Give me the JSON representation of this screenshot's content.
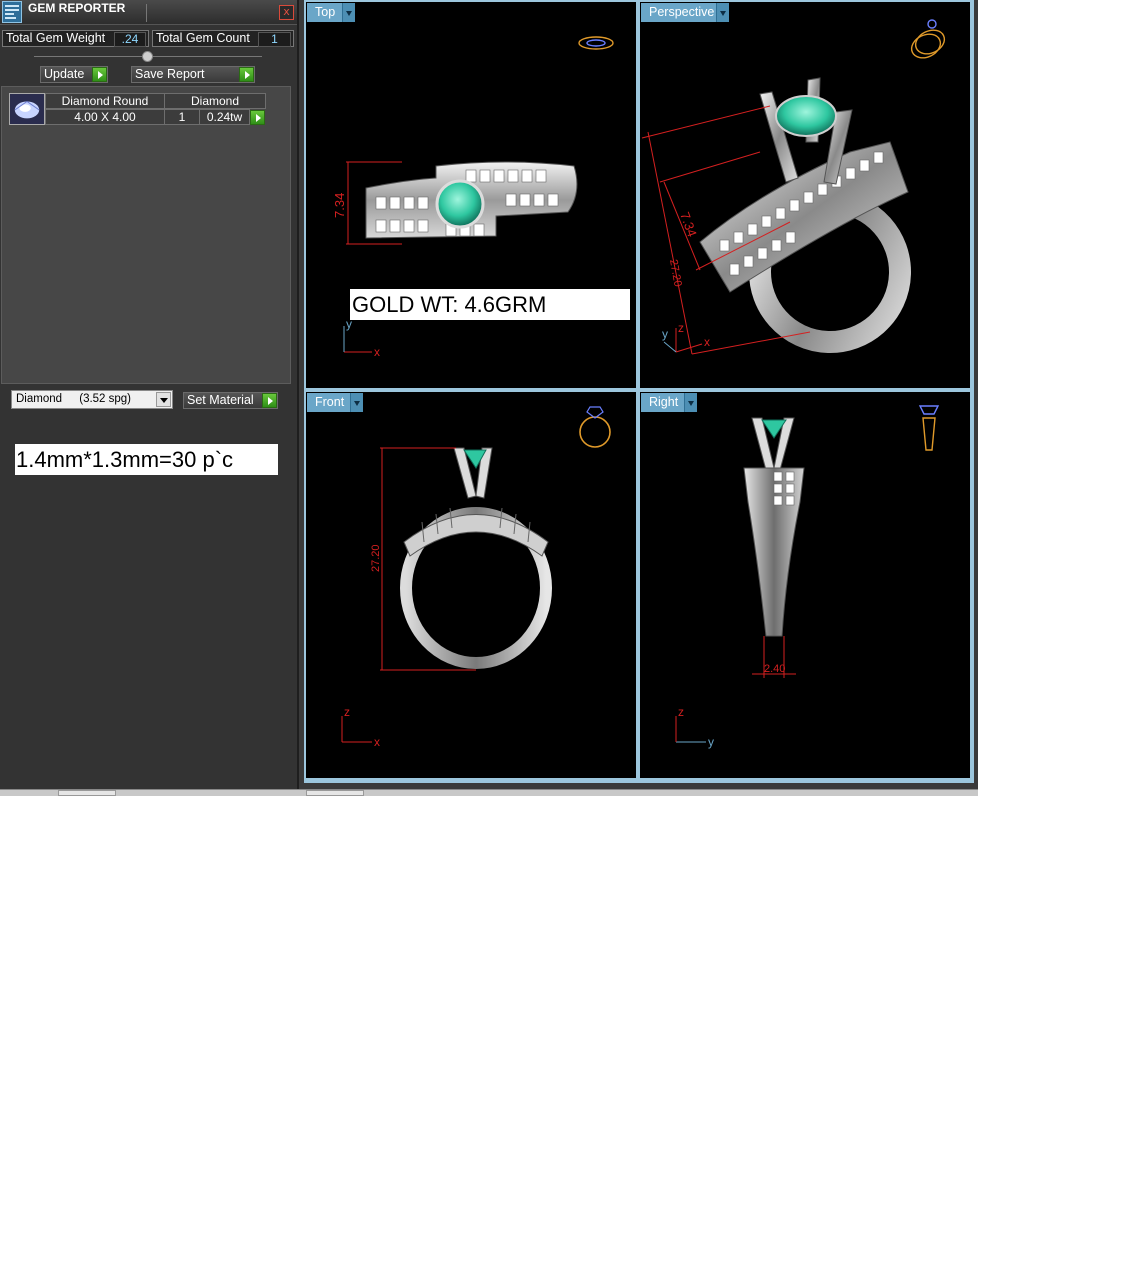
{
  "window": {
    "title": "GEM REPORTER",
    "close_label": "x"
  },
  "totals": {
    "weight_label": "Total Gem Weight",
    "weight_value": ".24",
    "count_label": "Total Gem Count",
    "count_value": "1"
  },
  "toolbar": {
    "update_label": "Update",
    "save_report_label": "Save Report"
  },
  "gem_table": {
    "shape_header": "Diamond Round",
    "material_header": "Diamond",
    "size": "4.00 X 4.00",
    "count": "1",
    "weight": "0.24tw"
  },
  "material": {
    "name": "Diamond",
    "spg": "(3.52 spg)",
    "set_label": "Set Material"
  },
  "note": "1.4mm*1.3mm=30 p`c",
  "viewports": {
    "top": {
      "tab": "Top",
      "dimension": "7.34",
      "gold_weight": "GOLD WT: 4.6GRM",
      "axis_v": "y",
      "axis_h": "x"
    },
    "perspective": {
      "tab": "Perspective",
      "dimension_a": "7.34",
      "dimension_b": "27.20",
      "axis_y": "y",
      "axis_z": "z",
      "axis_x": "x"
    },
    "front": {
      "tab": "Front",
      "dimension": "27.20",
      "axis_v": "z",
      "axis_h": "x"
    },
    "right": {
      "tab": "Right",
      "dimension": "2.40",
      "axis_v": "z",
      "axis_h": "y"
    }
  },
  "colors": {
    "panel": "#333333",
    "value_text": "#8fd8ff",
    "viewport_tab": "#6aa6c8",
    "viewport_border": "#9cc6dd",
    "dimension_red": "#d42020",
    "gem_green": "#2ec7a0",
    "go_green": "#4cae26"
  }
}
